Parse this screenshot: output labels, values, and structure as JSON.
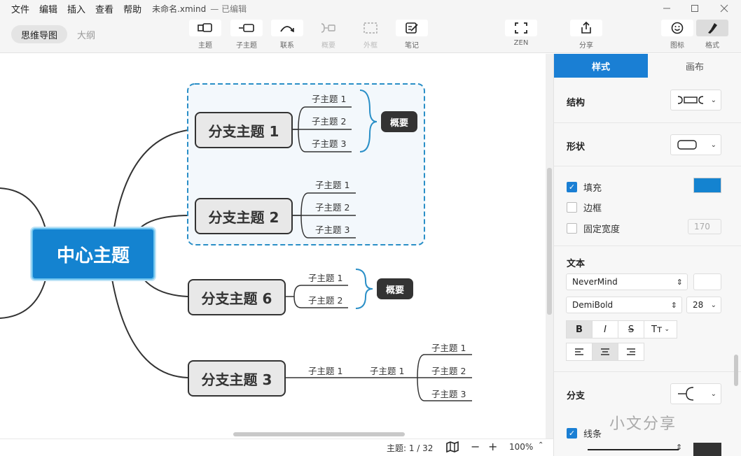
{
  "menu": {
    "items": [
      "文件",
      "编辑",
      "插入",
      "查看",
      "帮助"
    ],
    "doc_title": "未命名.xmind",
    "doc_status": "— 已编辑"
  },
  "view_toggle": {
    "mindmap": "思维导图",
    "outline": "大纲"
  },
  "toolbar": {
    "topic": "主题",
    "subtopic": "子主题",
    "relationship": "联系",
    "summary": "概要",
    "boundary": "外框",
    "notes": "笔记",
    "zen": "ZEN",
    "share": "分享",
    "icon": "图标",
    "format": "格式"
  },
  "mindmap": {
    "central": "中心主题",
    "branch1": {
      "label": "分支主题 1",
      "subs": [
        "子主题 1",
        "子主题 2",
        "子主题 3"
      ],
      "summary": "概要"
    },
    "branch2": {
      "label": "分支主题 2",
      "subs": [
        "子主题 1",
        "子主题 2",
        "子主题 3"
      ]
    },
    "branch6": {
      "label": "分支主题 6",
      "subs": [
        "子主题 1",
        "子主题 2"
      ],
      "summary": "概要"
    },
    "branch3": {
      "label": "分支主题 3",
      "sub": "子主题 1",
      "subsub": "子主题 1",
      "leaves": [
        "子主题 1",
        "子主题 2",
        "子主题 3"
      ]
    }
  },
  "status": {
    "topic_count": "主题: 1 / 32",
    "zoom": "100%"
  },
  "panel": {
    "tabs": {
      "style": "样式",
      "canvas": "画布"
    },
    "structure_label": "结构",
    "shape_label": "形状",
    "fill": {
      "label": "填充",
      "checked": true,
      "color": "#1483d0"
    },
    "border": {
      "label": "边框",
      "checked": false
    },
    "fixed_width": {
      "label": "固定宽度",
      "checked": false,
      "value": "170"
    },
    "text_label": "文本",
    "font_family": "NeverMind",
    "font_weight": "DemiBold",
    "font_size": "28",
    "text_style_buttons": [
      "B",
      "I",
      "S",
      "Tт"
    ],
    "branch_label": "分支",
    "line": {
      "label": "线条",
      "checked": true
    }
  },
  "watermark": "小文分享",
  "colors": {
    "accent": "#1a7fd4",
    "central": "#1483d0",
    "boundary": "#2a8fc7"
  }
}
